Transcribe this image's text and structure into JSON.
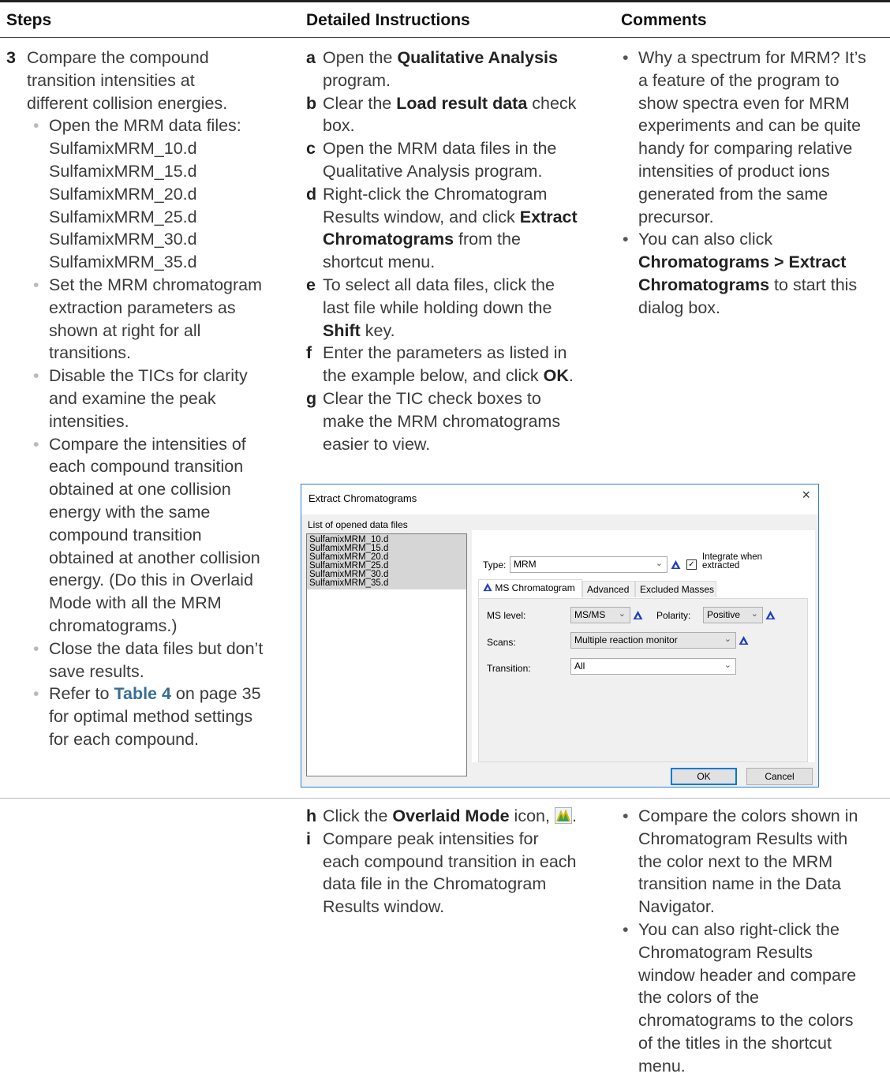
{
  "header": {
    "col_steps": "Steps",
    "col_instructions": "Detailed Instructions",
    "col_comments": "Comments"
  },
  "step3": {
    "number": "3",
    "text_lines": [
      "Compare the compound",
      "transition intensities at",
      "different collision energies."
    ],
    "bullets": [
      {
        "lines": [
          "Open the MRM data files:",
          "SulfamixMRM_10.d",
          "SulfamixMRM_15.d",
          "SulfamixMRM_20.d",
          "SulfamixMRM_25.d",
          "SulfamixMRM_30.d",
          "SulfamixMRM_35.d"
        ]
      },
      {
        "lines": [
          "Set the MRM chromatogram",
          "extraction parameters as",
          "shown at right for all",
          "transitions."
        ]
      },
      {
        "lines": [
          "Disable the TICs for clarity",
          "and examine the peak",
          "intensities."
        ]
      },
      {
        "lines": [
          "Compare the intensities of",
          "each compound transition",
          "obtained at one collision",
          "energy with the same",
          "compound transition",
          "obtained at another collision",
          "energy. (Do this in Overlaid",
          "Mode with all the MRM",
          "chromatograms.)"
        ]
      },
      {
        "lines": [
          "Close the data files but don’t",
          "save results."
        ]
      },
      {
        "pre": "Refer to ",
        "link": "Table 4",
        "post": " on page 35",
        "lines": [
          "for optimal method settings",
          "for each compound."
        ]
      }
    ]
  },
  "instructions_top": [
    {
      "letter": "a",
      "p1": "Open the ",
      "b1": "Qualitative Analysis",
      "p2": "",
      "l2": "program."
    },
    {
      "letter": "b",
      "p1": "Clear the ",
      "b1": "Load result data",
      "p2": " check",
      "l2": "box."
    },
    {
      "letter": "c",
      "l1": "Open the MRM data files in the",
      "l2": "Qualitative Analysis program."
    },
    {
      "letter": "d",
      "l1": "Right-click the Chromatogram",
      "l2p": "Results window, and click ",
      "l2b": "Extract",
      "l3b": "Chromatograms",
      "l3p": " from the",
      "l4": "shortcut menu."
    },
    {
      "letter": "e",
      "l1": "To select all data files, click the",
      "l2": "last file while holding down the",
      "l3b": "Shift",
      "l3p": " key."
    },
    {
      "letter": "f",
      "l1": "Enter the parameters as listed in",
      "l2p": "the example below, and click ",
      "l2b": "OK",
      "l2e": "."
    },
    {
      "letter": "g",
      "l1": "Clear the TIC check boxes to",
      "l2": "make the MRM chromatograms",
      "l3": "easier to view."
    }
  ],
  "comments_top": [
    {
      "lines": [
        "Why a spectrum for MRM? It’s",
        "a feature of the program to",
        "show spectra even for MRM",
        "experiments and can be quite",
        "handy for comparing relative",
        "intensities of product ions",
        "generated from the same",
        "precursor."
      ]
    },
    {
      "l1": "You can also click",
      "l2b": "Chromatograms > Extract",
      "l3b": "Chromatograms",
      "l3p": " to start this",
      "l4": "dialog box."
    }
  ],
  "dialog": {
    "title": "Extract Chromatograms",
    "close_glyph": "×",
    "list_label": "List of opened data files",
    "files": [
      "SulfamixMRM_10.d",
      "SulfamixMRM_15.d",
      "SulfamixMRM_20.d",
      "SulfamixMRM_25.d",
      "SulfamixMRM_30.d",
      "SulfamixMRM_35.d"
    ],
    "type_label": "Type:",
    "type_value": "MRM",
    "integrate_label_1": "Integrate when",
    "integrate_label_2": "extracted",
    "integrate_checked": true,
    "tabs": [
      "MS Chromatogram",
      "Advanced",
      "Excluded Masses"
    ],
    "ms_level_label": "MS level:",
    "ms_level_value": "MS/MS",
    "polarity_label": "Polarity:",
    "polarity_value": "Positive",
    "scans_label": "Scans:",
    "scans_value": "Multiple reaction monitor",
    "transition_label": "Transition:",
    "transition_value": "All",
    "ok_label": "OK",
    "cancel_label": "Cancel",
    "icon_color": "#1f3fbf",
    "accent_border": "#2f7ed8"
  },
  "instructions_bottom": [
    {
      "letter": "h",
      "p1": "Click the ",
      "b1": "Overlaid Mode",
      "p2": " icon, ",
      "icon": "overlaid-mode-icon",
      "p3": "."
    },
    {
      "letter": "i",
      "lines": [
        "Compare peak intensities for",
        "each compound transition in each",
        "data file in the Chromatogram",
        "Results window."
      ]
    }
  ],
  "comments_bottom": [
    {
      "lines": [
        "Compare the colors shown in",
        "Chromatogram Results with",
        "the color next to the MRM",
        "transition name in the Data",
        "Navigator."
      ]
    },
    {
      "lines": [
        "You can also right-click the",
        "Chromatogram Results",
        "window header and compare",
        "the colors of the",
        "chromatograms to the colors",
        "of the titles in the shortcut",
        "menu."
      ]
    }
  ]
}
